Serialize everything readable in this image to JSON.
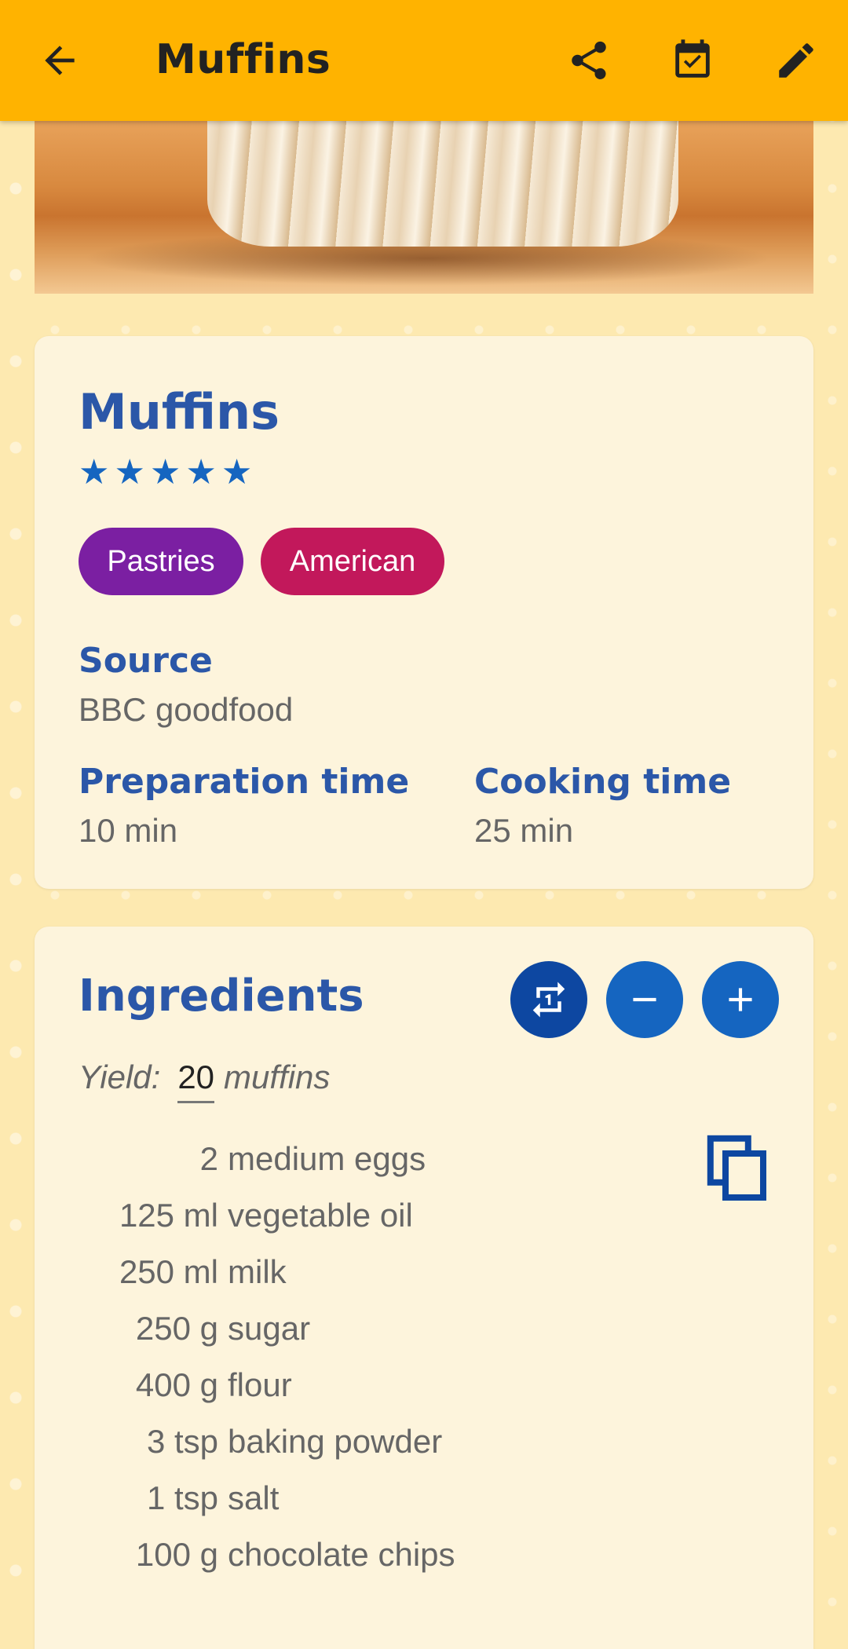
{
  "appbar": {
    "title": "Muffins"
  },
  "recipe": {
    "title": "Muffins",
    "rating": 5,
    "stars": [
      "★",
      "★",
      "★",
      "★",
      "★"
    ],
    "tags": [
      "Pastries",
      "American"
    ]
  },
  "details": {
    "source_label": "Source",
    "source_value": "BBC goodfood",
    "prep_label": "Preparation time",
    "prep_value": "10 min",
    "cook_label": "Cooking time",
    "cook_value": "25 min"
  },
  "ingredients": {
    "title": "Ingredients",
    "yield_label": "Yield:",
    "yield_value": "20",
    "yield_unit": "muffins",
    "items": [
      {
        "amount": "2",
        "text": "medium eggs"
      },
      {
        "amount": "125 ml",
        "text": "vegetable oil"
      },
      {
        "amount": "250 ml",
        "text": "milk"
      },
      {
        "amount": "250 g",
        "text": "sugar"
      },
      {
        "amount": "400 g",
        "text": "flour"
      },
      {
        "amount": "3 tsp",
        "text": "baking powder"
      },
      {
        "amount": "1 tsp",
        "text": "salt"
      },
      {
        "amount": "100 g",
        "text": "chocolate chips"
      }
    ]
  },
  "colors": {
    "appbar": "#ffb300",
    "heading": "#2b57a8",
    "chip_pastries": "#7b1fa2",
    "chip_american": "#c2185b",
    "fab_primary": "#1565c0"
  }
}
